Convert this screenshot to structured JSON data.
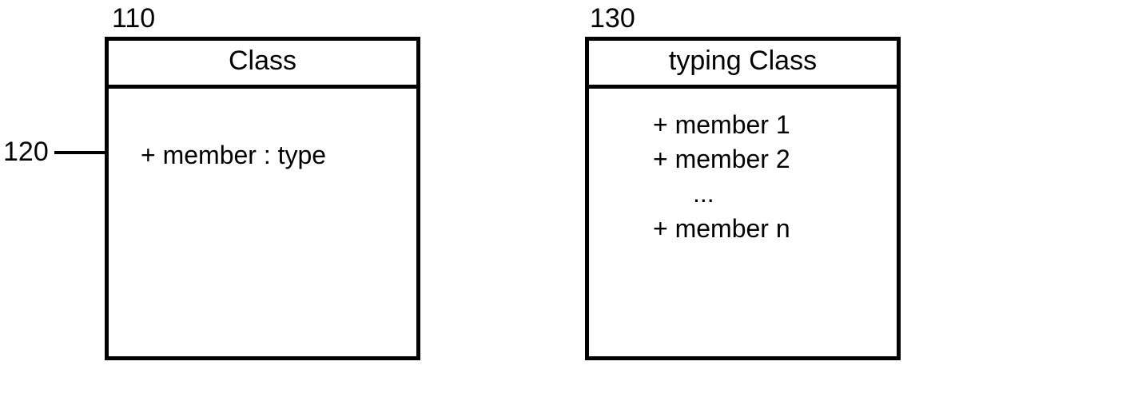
{
  "labels": {
    "ref110": "110",
    "ref120": "120",
    "ref130": "130"
  },
  "leftBox": {
    "title": "Class",
    "member": "+ member : type"
  },
  "rightBox": {
    "title": "typing Class",
    "members": {
      "m1": "+ member 1",
      "m2": "+ member 2",
      "ellipsis": "...",
      "mn": "+ member n"
    }
  }
}
